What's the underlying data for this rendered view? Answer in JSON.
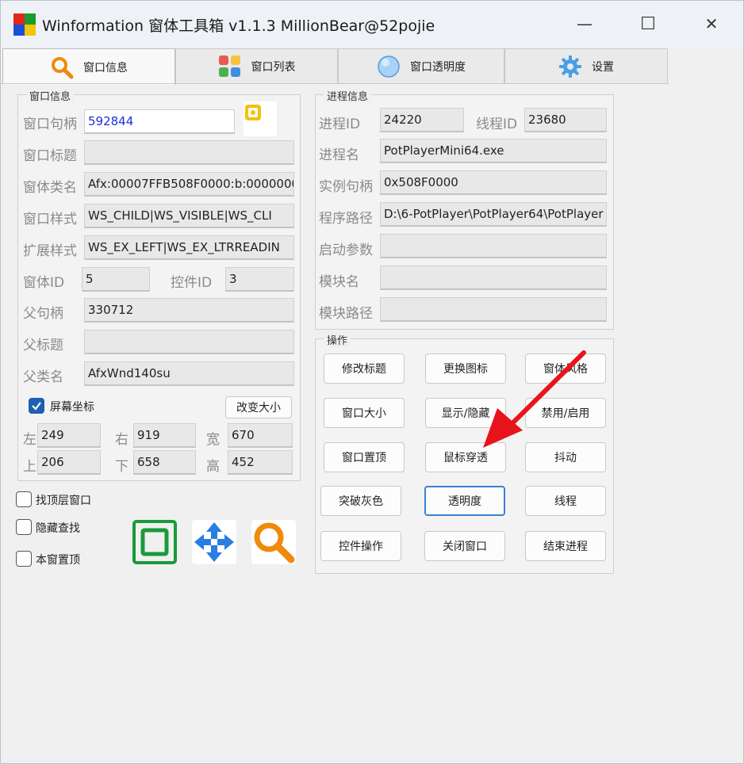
{
  "title": "Winformation 窗体工具箱 v1.1.3  MillionBear@52pojie",
  "window_buttons": {
    "minimize": "—",
    "maximize": "☐",
    "close": "✕"
  },
  "tabs": [
    {
      "label": "窗口信息",
      "icon": "search-icon"
    },
    {
      "label": "窗口列表",
      "icon": "grid-icon"
    },
    {
      "label": "窗口透明度",
      "icon": "circle-icon"
    },
    {
      "label": "设置",
      "icon": "gear-icon"
    }
  ],
  "window_info": {
    "group_title": "窗口信息",
    "handle_label": "窗口句柄",
    "handle": "592844",
    "title_label": "窗口标题",
    "title": "",
    "class_label": "窗体类名",
    "class": "Afx:00007FFB508F0000:b:0000000",
    "style_label": "窗口样式",
    "style": "WS_CHILD|WS_VISIBLE|WS_CLI",
    "exstyle_label": "扩展样式",
    "exstyle": "WS_EX_LEFT|WS_EX_LTRREADIN",
    "id_label": "窗体ID",
    "id": "5",
    "ctrl_id_label": "控件ID",
    "ctrl_id": "3",
    "parent_handle_label": "父句柄",
    "parent_handle": "330712",
    "parent_title_label": "父标题",
    "parent_title": "",
    "parent_class_label": "父类名",
    "parent_class": "AfxWnd140su",
    "screen_coords_label": "屏幕坐标",
    "resize_button": "改变大小",
    "left_label": "左",
    "left": "249",
    "right_label": "右",
    "right": "919",
    "width_label": "宽",
    "width": "670",
    "top_label": "上",
    "top": "206",
    "bottom_label": "下",
    "bottom": "658",
    "height_label": "高",
    "height": "452"
  },
  "options": {
    "find_top": "找顶层窗口",
    "hide_find": "隐藏查找",
    "pin_top": "本窗置顶"
  },
  "process_info": {
    "group_title": "进程信息",
    "pid_label": "进程ID",
    "pid": "24220",
    "tid_label": "线程ID",
    "tid": "23680",
    "name_label": "进程名",
    "name": "PotPlayerMini64.exe",
    "instance_label": "实例句柄",
    "instance": "0x508F0000",
    "path_label": "程序路径",
    "path": "D:\\6-PotPlayer\\PotPlayer64\\PotPlayer",
    "args_label": "启动参数",
    "args": "",
    "module_label": "模块名",
    "module": "",
    "module_path_label": "模块路径",
    "module_path": ""
  },
  "operations": {
    "group_title": "操作",
    "buttons": [
      "修改标题",
      "更换图标",
      "窗体风格",
      "窗口大小",
      "显示/隐藏",
      "禁用/启用",
      "窗口置顶",
      "鼠标穿透",
      "抖动",
      "突破灰色",
      "透明度",
      "线程",
      "控件操作",
      "关闭窗口",
      "结束进程"
    ]
  },
  "colors": {
    "accent": "#1f5fb3",
    "arrow": "#e8141c",
    "handle_text": "#1b2fd6"
  }
}
